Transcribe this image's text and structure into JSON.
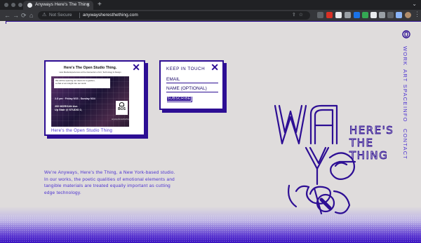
{
  "browser": {
    "tab_title": "Anyways Here's The Thing",
    "tab_close": "×",
    "new_tab": "+",
    "tab_menu": "⌄",
    "back": "←",
    "forward": "→",
    "reload": "⟳",
    "home": "⌂",
    "security_label": "Not Secure",
    "url": "anywaysheresthething.com",
    "colors": {
      "chrome": "#202124",
      "toolbar": "#35363a"
    }
  },
  "newsletter": {
    "title": "KEEP IN TOUCH",
    "email_placeholder": "EMAIL",
    "name_placeholder": "NAME (OPTIONAL)",
    "subscribe_label": "SUBSCRIBE",
    "close": "✕"
  },
  "poster": {
    "title": "Here's The Open Studio Thing.",
    "subtitle": "How Media Experiences at the intersection of Art, Technology & Design",
    "note_line1": "We will be opening our doors for a garden,",
    "note_line2": "a chat or an insight into our work.",
    "date": "2-8 pm · Friday 9/23 - Sunday 9/24",
    "address_line1": "200 MORGAN Ave.",
    "address_line2": "Up Stair @ STUDIO 2,",
    "logo_text": "BOS",
    "footer": "anywaysheresthething.com",
    "caption": "Here's the Open Studio Thing",
    "close": "✕"
  },
  "intro": "We're Anyways, Here's the Thing, a New York-based studio. In our works, the poetic qualities of emotional elements and tangible materials are treated equally important as cutting edge technology.",
  "logo": {
    "line1": "HERE'S",
    "line2": "THE",
    "line3": "THING"
  },
  "nav": {
    "items": [
      {
        "label": "WORK"
      },
      {
        "label": "ART SPACE"
      },
      {
        "label": "INFO"
      },
      {
        "label": "CONTACT"
      }
    ]
  },
  "brand_colors": {
    "primary": "#2d0e94",
    "text": "#4a2fd0",
    "background": "#dfdcdc"
  }
}
